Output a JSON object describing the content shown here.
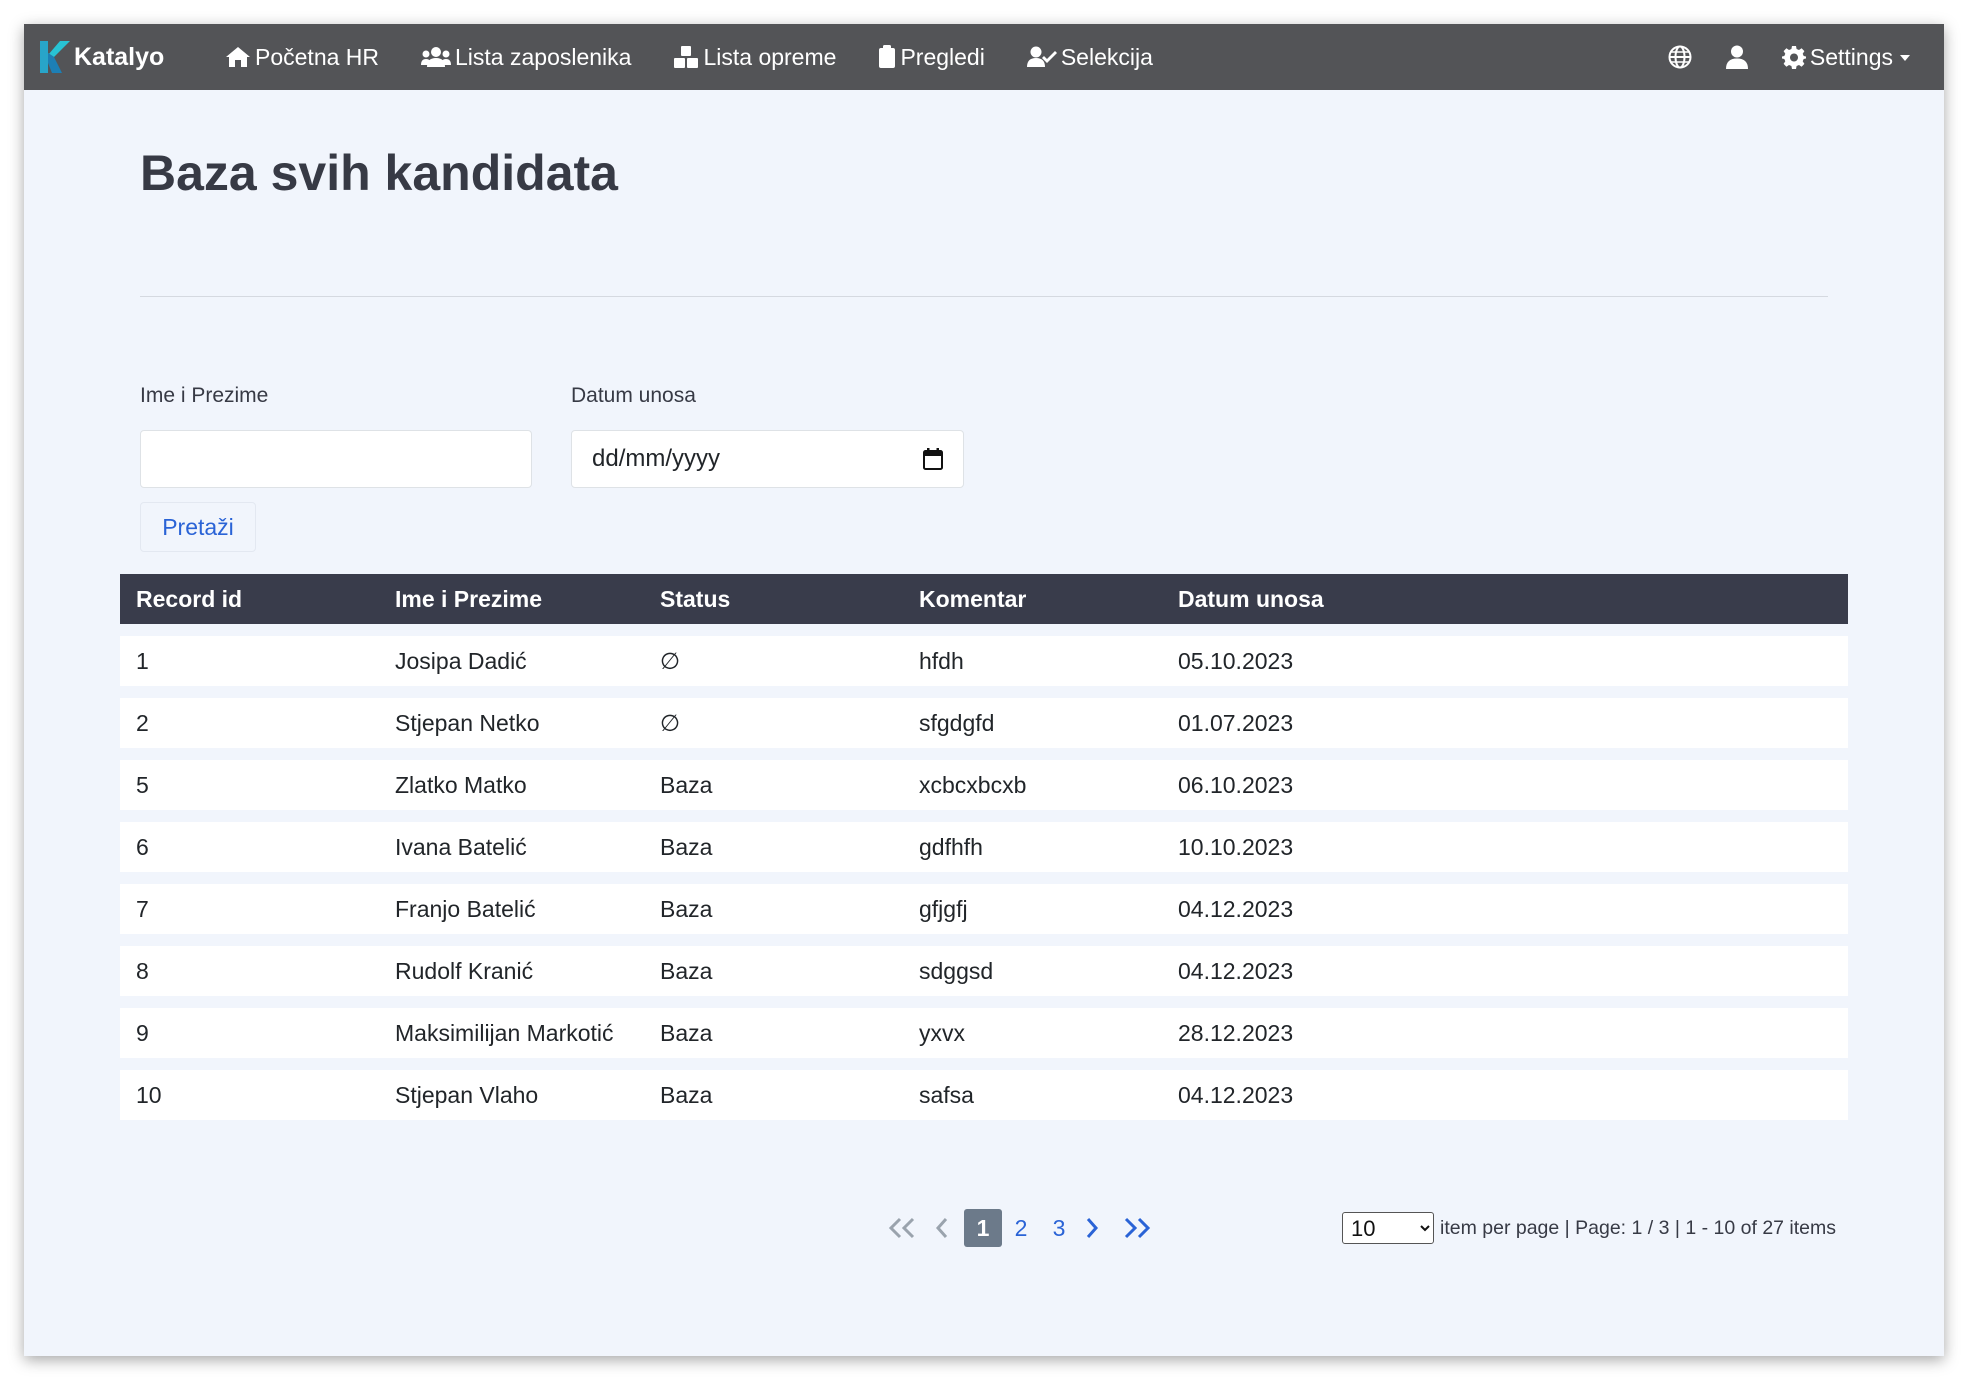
{
  "navbar": {
    "brand": "Katalyo",
    "links": [
      {
        "label": "Početna HR",
        "icon": "home-icon"
      },
      {
        "label": "Lista zaposlenika",
        "icon": "users-icon"
      },
      {
        "label": "Lista opreme",
        "icon": "boxes-icon"
      },
      {
        "label": "Pregledi",
        "icon": "clipboard-icon"
      },
      {
        "label": "Selekcija",
        "icon": "user-check-icon"
      }
    ],
    "right": {
      "language_icon": "globe-icon",
      "user_icon": "user-icon",
      "settings_label": "Settings",
      "settings_icon": "gear-icon"
    }
  },
  "page": {
    "title": "Baza svih kandidata"
  },
  "filters": {
    "name_label": "Ime i Prezime",
    "name_value": "",
    "date_label": "Datum unosa",
    "date_placeholder": "dd/mm/yyyy",
    "search_button": "Pretaži"
  },
  "table": {
    "columns": [
      "Record id",
      "Ime i Prezime",
      "Status",
      "Komentar",
      "Datum unosa"
    ],
    "rows": [
      [
        "1",
        "Josipa Dadić",
        "∅",
        "hfdh",
        "05.10.2023"
      ],
      [
        "2",
        "Stjepan Netko",
        "∅",
        "sfgdgfd",
        "01.07.2023"
      ],
      [
        "5",
        "Zlatko Matko",
        "Baza",
        "xcbcxbcxb",
        "06.10.2023"
      ],
      [
        "6",
        "Ivana Batelić",
        "Baza",
        "gdfhfh",
        "10.10.2023"
      ],
      [
        "7",
        "Franjo Batelić",
        "Baza",
        "gfjgfj",
        "04.12.2023"
      ],
      [
        "8",
        "Rudolf Kranić",
        "Baza",
        "sdggsd",
        "04.12.2023"
      ],
      [
        "9",
        "Maksimilijan Markotić",
        "Baza",
        "yxvx",
        "28.12.2023"
      ],
      [
        "10",
        "Stjepan Vlaho",
        "Baza",
        "safsa",
        "04.12.2023"
      ]
    ]
  },
  "pagination": {
    "pages": [
      "1",
      "2",
      "3"
    ],
    "current_page": "1",
    "page_size": "10",
    "page_size_options": [
      "10"
    ],
    "info": "item per page | Page: 1 / 3 | 1 - 10 of 27 items",
    "colors": {
      "active_bg": "#6c7a8a",
      "link": "#2a63d6",
      "disabled": "#9aa3ad"
    }
  }
}
